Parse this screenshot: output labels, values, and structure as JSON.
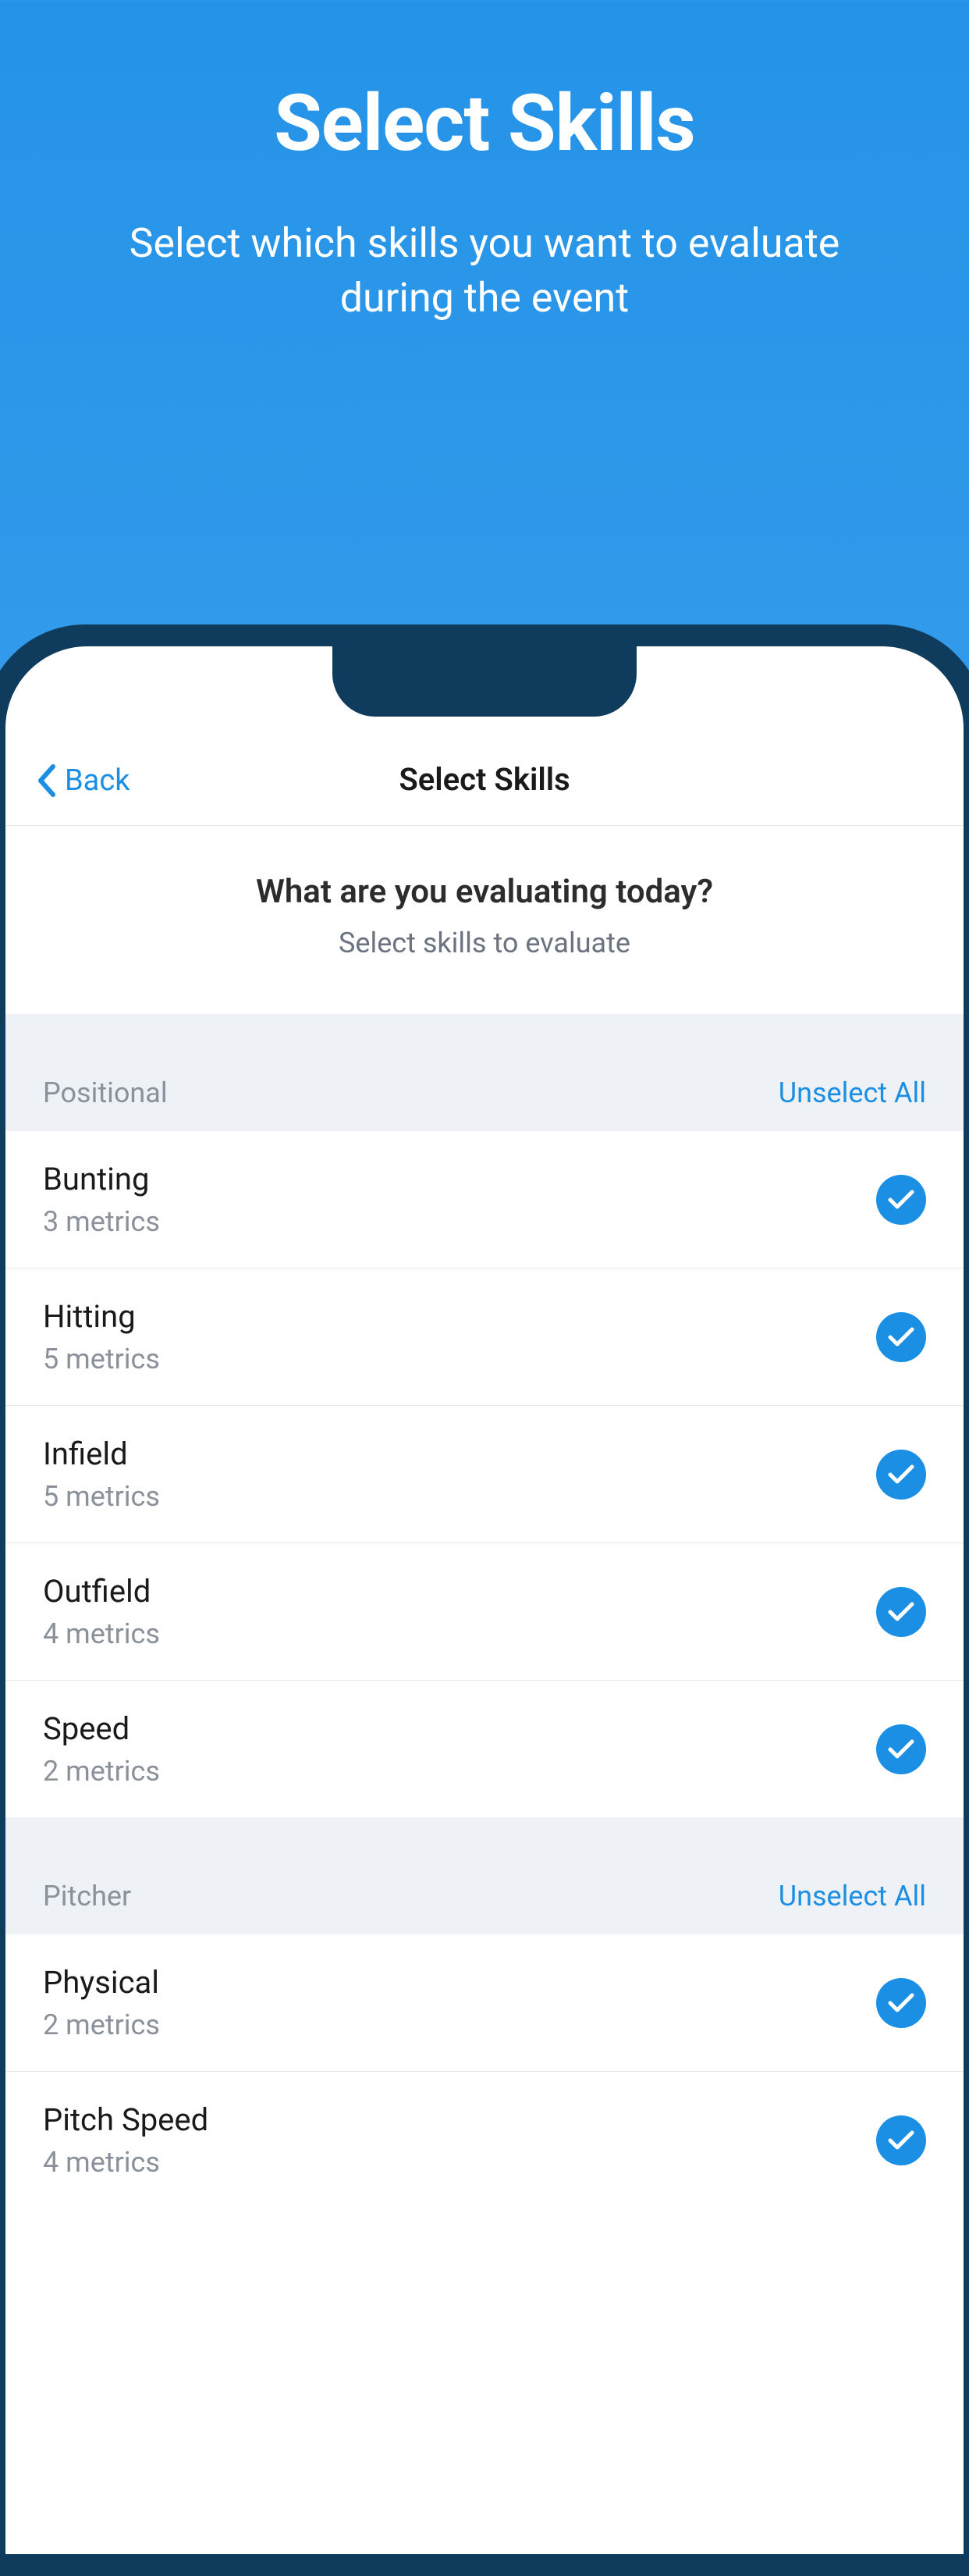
{
  "promo": {
    "title": "Select Skills",
    "subtitle": "Select which skills you want to evaluate during the event"
  },
  "nav": {
    "back_label": "Back",
    "title": "Select Skills"
  },
  "question": {
    "title": "What are you evaluating today?",
    "subtitle": "Select skills to evaluate"
  },
  "sections": [
    {
      "title": "Positional",
      "action": "Unselect All",
      "skills": [
        {
          "name": "Bunting",
          "metrics": "3 metrics",
          "selected": true
        },
        {
          "name": "Hitting",
          "metrics": "5 metrics",
          "selected": true
        },
        {
          "name": "Infield",
          "metrics": "5 metrics",
          "selected": true
        },
        {
          "name": "Outfield",
          "metrics": "4 metrics",
          "selected": true
        },
        {
          "name": "Speed",
          "metrics": "2 metrics",
          "selected": true
        }
      ]
    },
    {
      "title": "Pitcher",
      "action": "Unselect All",
      "skills": [
        {
          "name": "Physical",
          "metrics": "2 metrics",
          "selected": true
        },
        {
          "name": "Pitch Speed",
          "metrics": "4 metrics",
          "selected": true
        }
      ]
    }
  ],
  "colors": {
    "accent": "#1A8FE3"
  }
}
